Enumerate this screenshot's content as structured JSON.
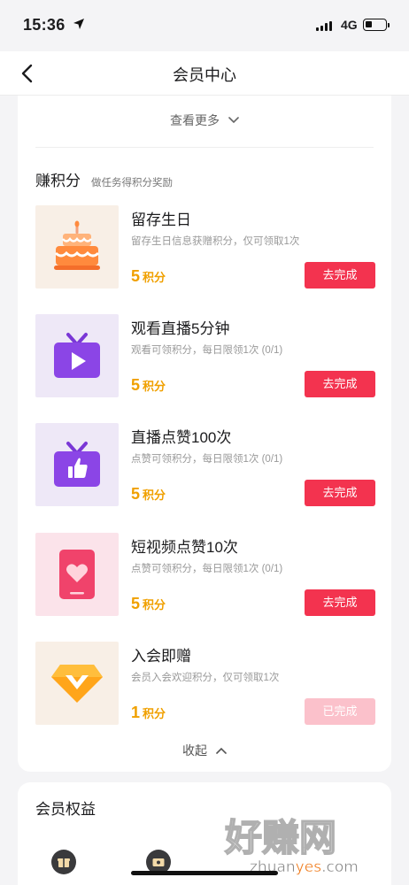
{
  "status_bar": {
    "time": "15:36",
    "network": "4G"
  },
  "header": {
    "title": "会员中心",
    "back_icon": "chevron-left-icon"
  },
  "tasks_card": {
    "see_more": "查看更多",
    "section_title": "赚积分",
    "section_subtitle": "做任务得积分奖励",
    "tasks": [
      {
        "title": "留存生日",
        "desc": "留存生日信息获赠积分，仅可领取1次",
        "points": "5",
        "unit": "积分",
        "button": "去完成",
        "done": false,
        "icon": "birthday-cake-icon"
      },
      {
        "title": "观看直播5分钟",
        "desc": "观看可领积分，每日限领1次 (0/1)",
        "points": "5",
        "unit": "积分",
        "button": "去完成",
        "done": false,
        "icon": "tv-play-icon"
      },
      {
        "title": "直播点赞100次",
        "desc": "点赞可领积分，每日限领1次 (0/1)",
        "points": "5",
        "unit": "积分",
        "button": "去完成",
        "done": false,
        "icon": "tv-thumbs-up-icon"
      },
      {
        "title": "短视频点赞10次",
        "desc": "点赞可领积分，每日限领1次 (0/1)",
        "points": "5",
        "unit": "积分",
        "button": "去完成",
        "done": false,
        "icon": "phone-heart-icon"
      },
      {
        "title": "入会即赠",
        "desc": "会员入会欢迎积分，仅可领取1次",
        "points": "1",
        "unit": "积分",
        "button": "已完成",
        "done": true,
        "icon": "diamond-badge-icon"
      }
    ],
    "collapse": "收起"
  },
  "benefits_card": {
    "title": "会员权益"
  },
  "watermark": {
    "text_cn": "好赚网",
    "text_url_a": "zhuan",
    "text_url_b": "yes",
    "text_url_c": ".com"
  },
  "colors": {
    "accent": "#f3334f",
    "accent_disabled": "#fbc1cb",
    "points": "#f0a000"
  }
}
